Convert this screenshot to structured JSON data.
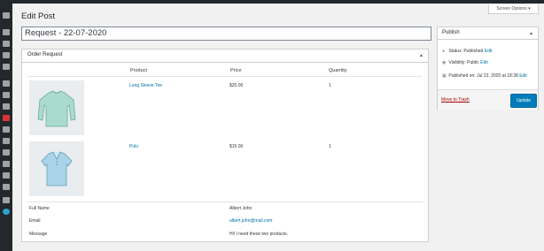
{
  "screen_options": "Screen Options ▾",
  "page_title": "Edit Post",
  "post_title": "Request - 22-07-2020",
  "order_box": {
    "title": "Order Request",
    "toggle": "▲",
    "columns": [
      "Product",
      "Price",
      "Quantity"
    ],
    "items": [
      {
        "product": "Long Sleeve Tee",
        "price": "$25.00",
        "quantity": "1",
        "image_icon": "long-sleeve-tee-image"
      },
      {
        "product": "Polo",
        "price": "$15.00",
        "quantity": "1",
        "image_icon": "polo-shirt-image"
      }
    ],
    "details": [
      {
        "label": "Full Name",
        "value": "Albert John"
      },
      {
        "label": "Email",
        "value": "albert.john@mail.com"
      },
      {
        "label": "Message",
        "value": "Hi! I need these two products."
      }
    ]
  },
  "publish": {
    "title": "Publish",
    "toggle": "▲",
    "status_label": "Status: Published",
    "visibility_label": "Visibility: Public",
    "published_label": "Published on: Jul 22, 2020 at 18:38",
    "edit": "Edit",
    "trash": "Move to Trash",
    "update": "Update"
  }
}
